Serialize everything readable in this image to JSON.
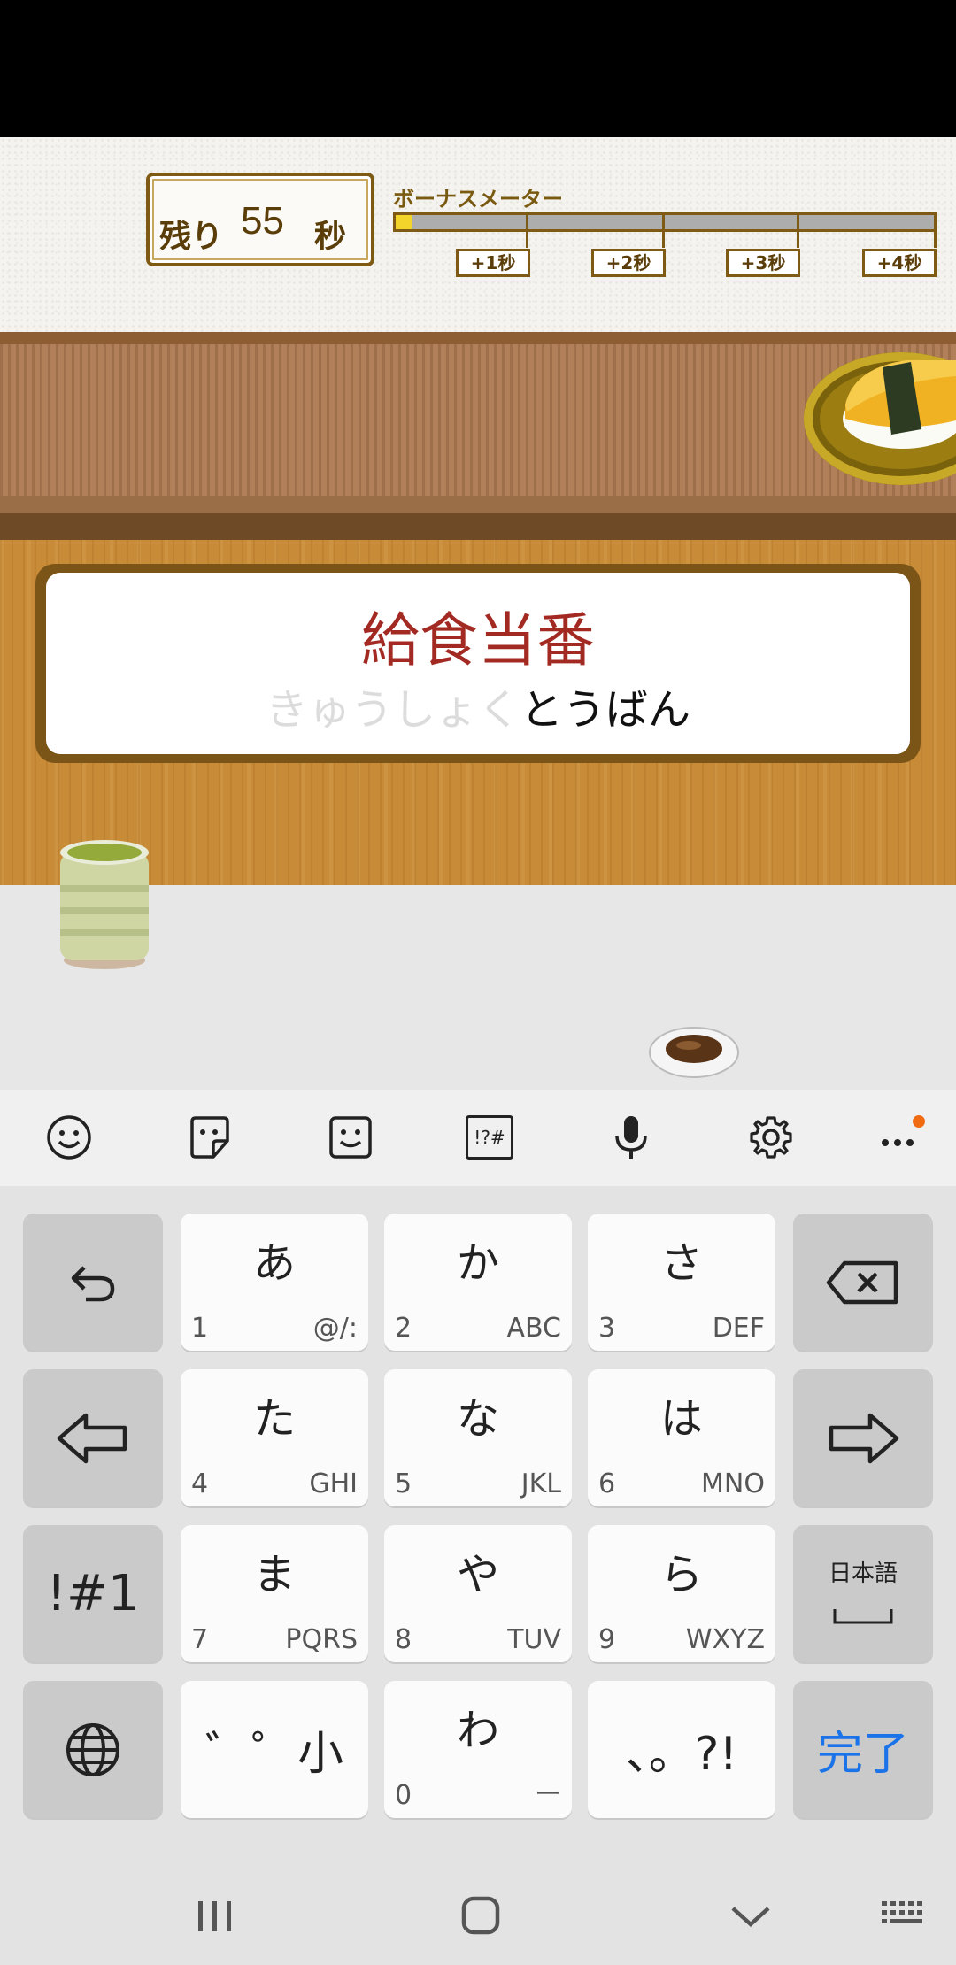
{
  "header": {
    "timer_prefix": "残り",
    "timer_value": "55",
    "timer_suffix": "秒",
    "meter_title": "ボーナスメーター",
    "meter_fill": 0.03,
    "tags": [
      "+1秒",
      "+2秒",
      "+3秒",
      "+4秒"
    ]
  },
  "word": {
    "kanji": "給食当番",
    "typed": "きゅうしょく",
    "remaining": "とうばん"
  },
  "toolbar": {
    "icons": [
      "emoji-icon",
      "sticker-icon",
      "kaomoji-icon",
      "symbols-icon",
      "mic-icon",
      "settings-icon",
      "more-icon"
    ],
    "symbols_label": "!?#"
  },
  "keyboard": {
    "rows": [
      [
        {
          "name": "undo-key",
          "type": "icon",
          "icon": "undo-icon"
        },
        {
          "name": "key-a",
          "main": "あ",
          "num": "1",
          "sub": "@/:"
        },
        {
          "name": "key-ka",
          "main": "か",
          "num": "2",
          "sub": "ABC"
        },
        {
          "name": "key-sa",
          "main": "さ",
          "num": "3",
          "sub": "DEF"
        },
        {
          "name": "backspace-key",
          "type": "icon",
          "icon": "backspace-icon"
        }
      ],
      [
        {
          "name": "cursor-left-key",
          "type": "icon",
          "icon": "arrow-left-icon"
        },
        {
          "name": "key-ta",
          "main": "た",
          "num": "4",
          "sub": "GHI"
        },
        {
          "name": "key-na",
          "main": "な",
          "num": "5",
          "sub": "JKL"
        },
        {
          "name": "key-ha",
          "main": "は",
          "num": "6",
          "sub": "MNO"
        },
        {
          "name": "cursor-right-key",
          "type": "icon",
          "icon": "arrow-right-icon"
        }
      ],
      [
        {
          "name": "symbol-mode-key",
          "center": "!#1"
        },
        {
          "name": "key-ma",
          "main": "ま",
          "num": "7",
          "sub": "PQRS"
        },
        {
          "name": "key-ya",
          "main": "や",
          "num": "8",
          "sub": "TUV"
        },
        {
          "name": "key-ra",
          "main": "ら",
          "num": "9",
          "sub": "WXYZ"
        },
        {
          "name": "space-key",
          "label": "日本語"
        }
      ],
      [
        {
          "name": "language-key",
          "type": "icon",
          "icon": "globe-icon"
        },
        {
          "name": "dakuten-key",
          "center": "゛゜小"
        },
        {
          "name": "key-wa",
          "main": "わ",
          "num": "0",
          "sub": "ー"
        },
        {
          "name": "punctuation-key",
          "center": "、。?!"
        },
        {
          "name": "done-key",
          "center": "完了"
        }
      ]
    ]
  },
  "colors": {
    "accent": "#1a73e8",
    "kanji": "#a32a23",
    "notification_dot": "#f06a12"
  }
}
